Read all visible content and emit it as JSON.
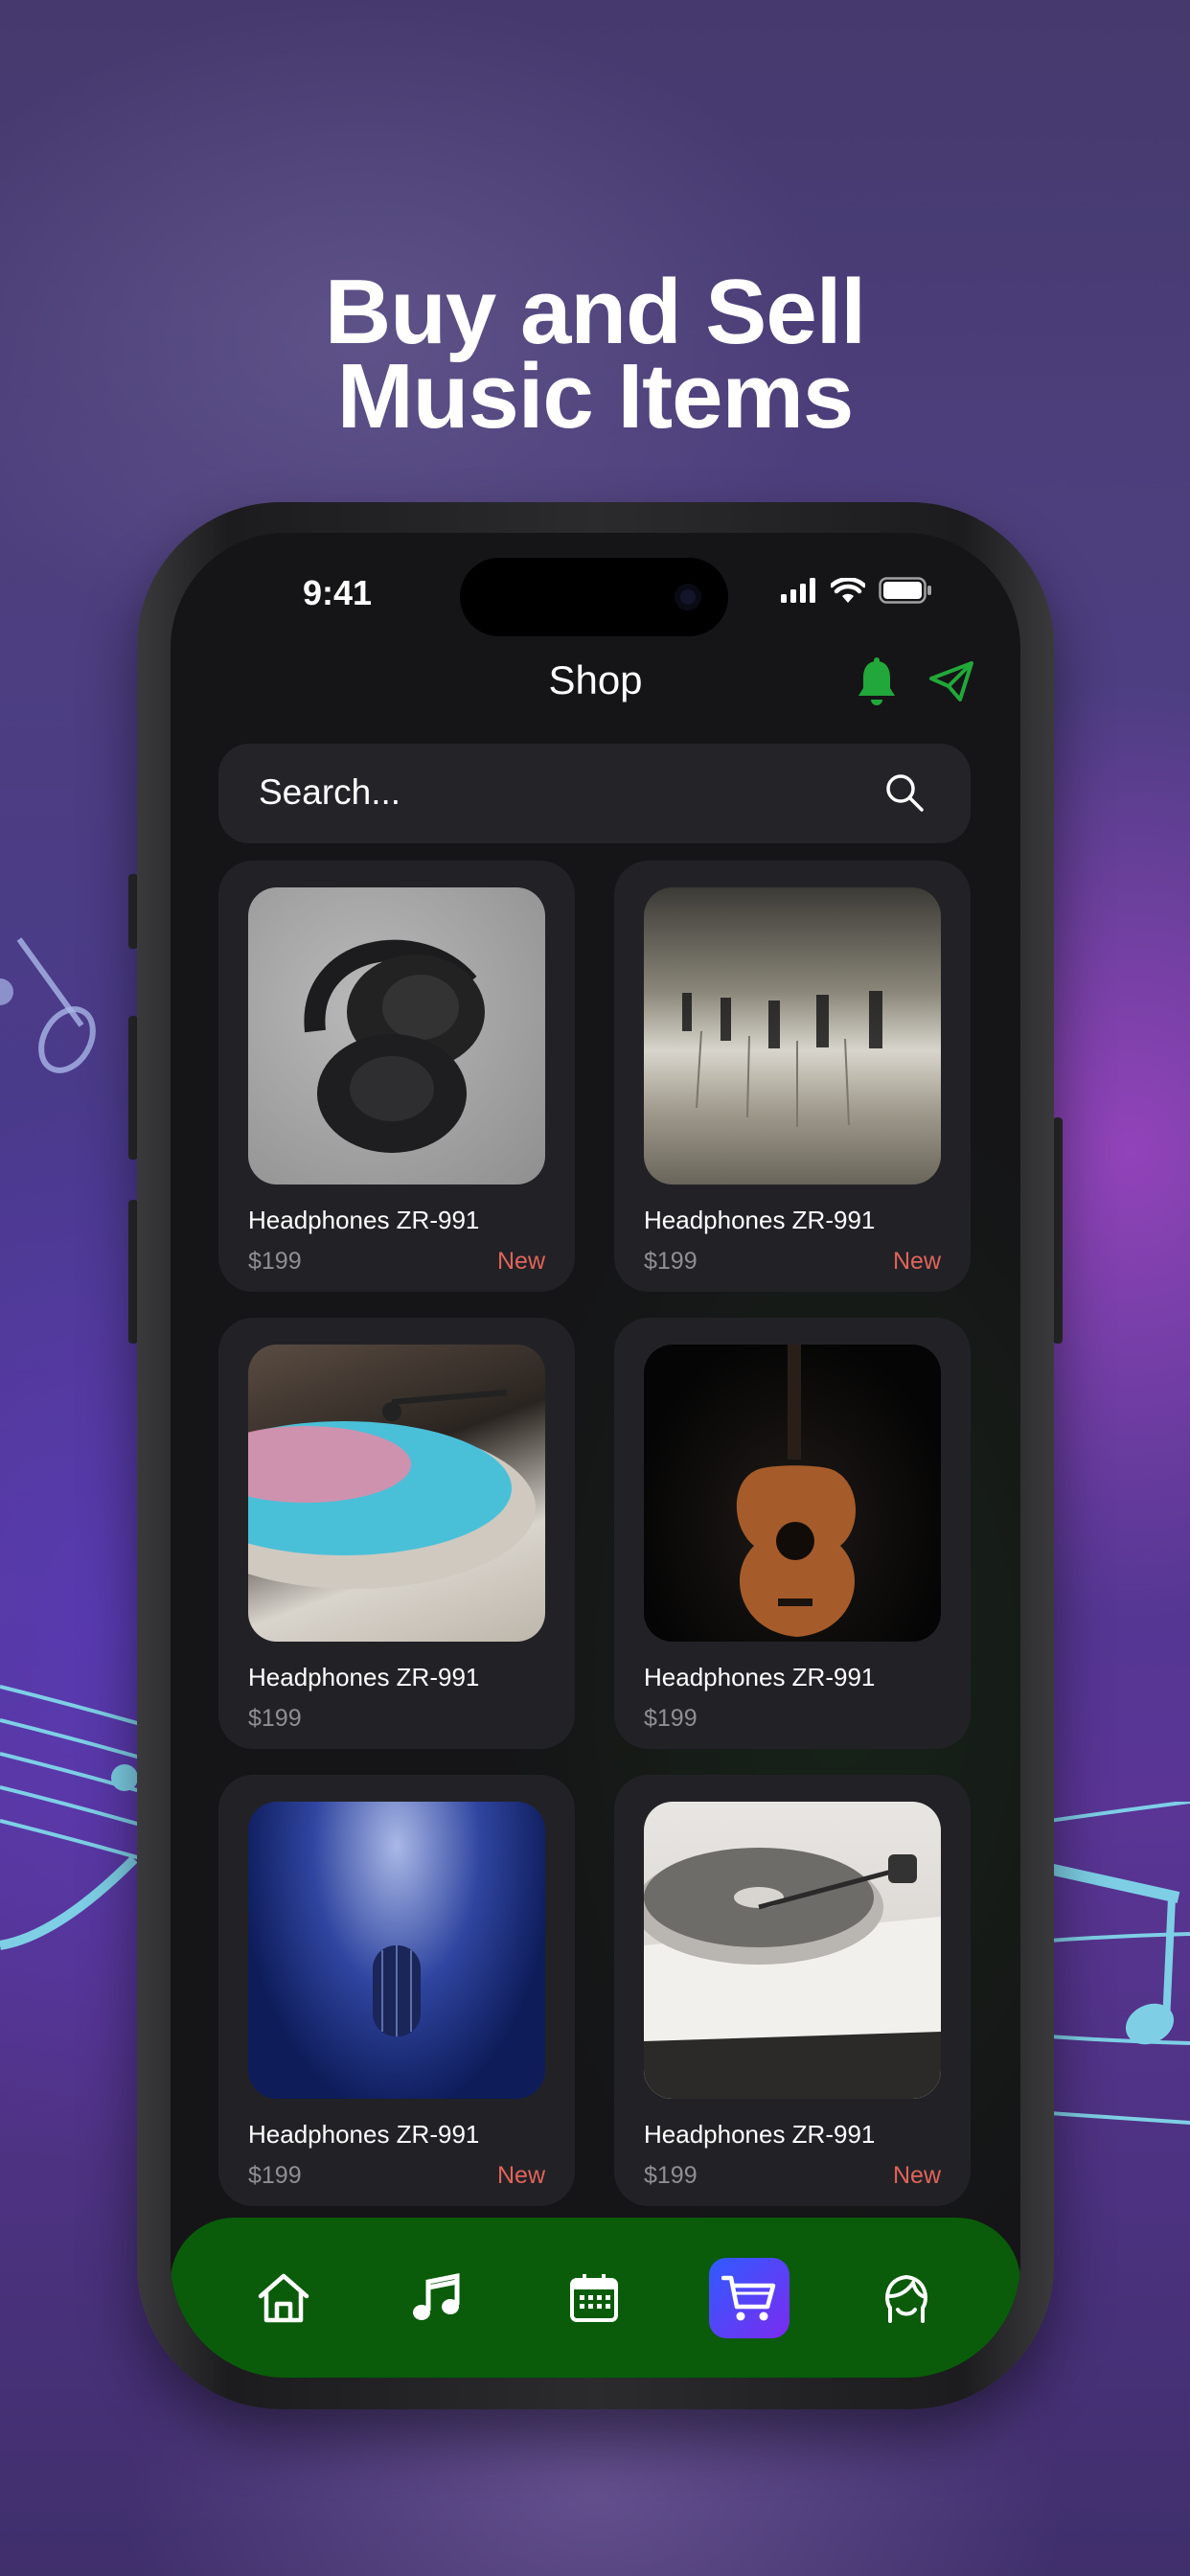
{
  "headline": {
    "line1": "Buy and Sell",
    "line2": "Music Items"
  },
  "status_bar": {
    "time": "9:41"
  },
  "header": {
    "title": "Shop",
    "icons": [
      "bell-icon",
      "send-icon"
    ]
  },
  "search": {
    "placeholder": "Search..."
  },
  "products": [
    {
      "name": "Headphones ZR-991",
      "price": "$199",
      "tag": "New",
      "image": "headphones"
    },
    {
      "name": "Headphones ZR-991",
      "price": "$199",
      "tag": "New",
      "image": "piano-keys"
    },
    {
      "name": "Headphones ZR-991",
      "price": "$199",
      "tag": "",
      "image": "turntable-blue-vinyl"
    },
    {
      "name": "Headphones ZR-991",
      "price": "$199",
      "tag": "",
      "image": "acoustic-guitar"
    },
    {
      "name": "Headphones ZR-991",
      "price": "$199",
      "tag": "New",
      "image": "microphone-spotlight"
    },
    {
      "name": "Headphones ZR-991",
      "price": "$199",
      "tag": "New",
      "image": "record-player"
    }
  ],
  "tab_bar": {
    "items": [
      "home-icon",
      "music-icon",
      "calendar-icon",
      "cart-icon",
      "profile-icon"
    ],
    "active": "cart-icon"
  },
  "colors": {
    "accent_green": "#22a83a",
    "tab_bar_bg": "#0a5c0a",
    "new_tag": "#e0645a",
    "active_tab_gradient": [
      "#2f5cff",
      "#7b2bf0"
    ]
  }
}
